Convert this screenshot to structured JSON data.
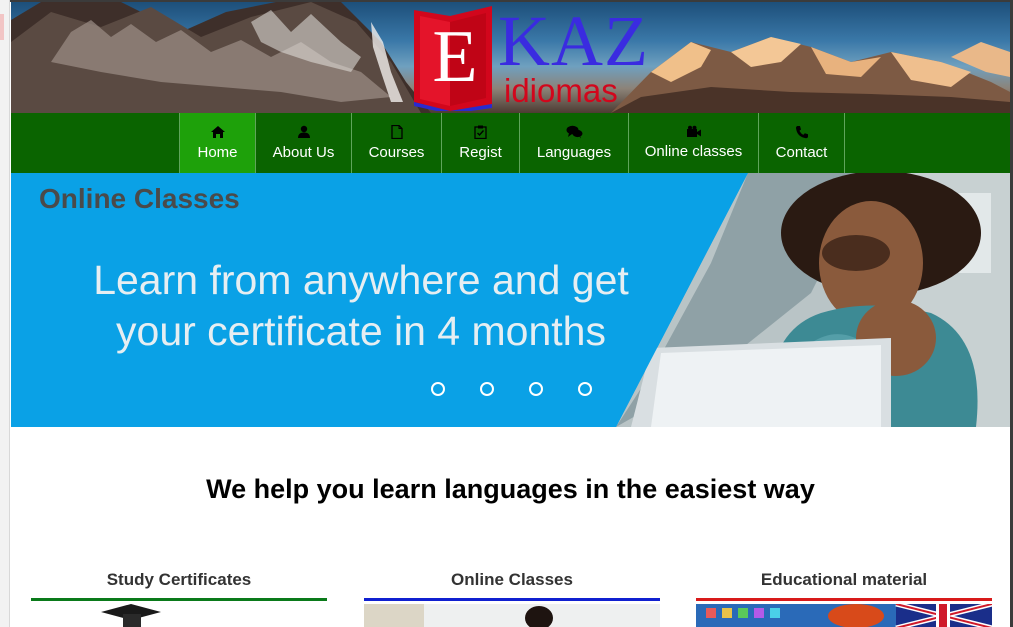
{
  "logo": {
    "letter": "E",
    "wordmark": "KAZ",
    "tagline": "idiomas"
  },
  "nav": {
    "items": [
      {
        "label": "Home",
        "icon": "home-icon",
        "active": true
      },
      {
        "label": "About Us",
        "icon": "user-icon",
        "active": false
      },
      {
        "label": "Courses",
        "icon": "document-icon",
        "active": false
      },
      {
        "label": "Regist",
        "icon": "clipboard-check-icon",
        "active": false
      },
      {
        "label": "Languages",
        "icon": "chat-bubbles-icon",
        "active": false
      },
      {
        "label": "Online classes",
        "icon": "video-camera-icon",
        "active": false
      },
      {
        "label": "Contact",
        "icon": "phone-icon",
        "active": false
      }
    ]
  },
  "hero": {
    "title": "Online Classes",
    "text_line1": "Learn from anywhere and get",
    "text_line2": "your certificate in 4 months",
    "slide_count": 4
  },
  "main": {
    "tagline": "We help you learn languages in the easiest way",
    "cards": [
      {
        "title": "Study Certificates",
        "accent": "#0a7a1a"
      },
      {
        "title": "Online Classes",
        "accent": "#1020d0"
      },
      {
        "title": "Educational material",
        "accent": "#d81a1a"
      }
    ]
  },
  "colors": {
    "nav_bg": "#0a6400",
    "nav_active": "#1ea10a",
    "hero_blue": "#0aa1e6",
    "logo_blue": "#3a2be0",
    "logo_red": "#d2061c"
  }
}
